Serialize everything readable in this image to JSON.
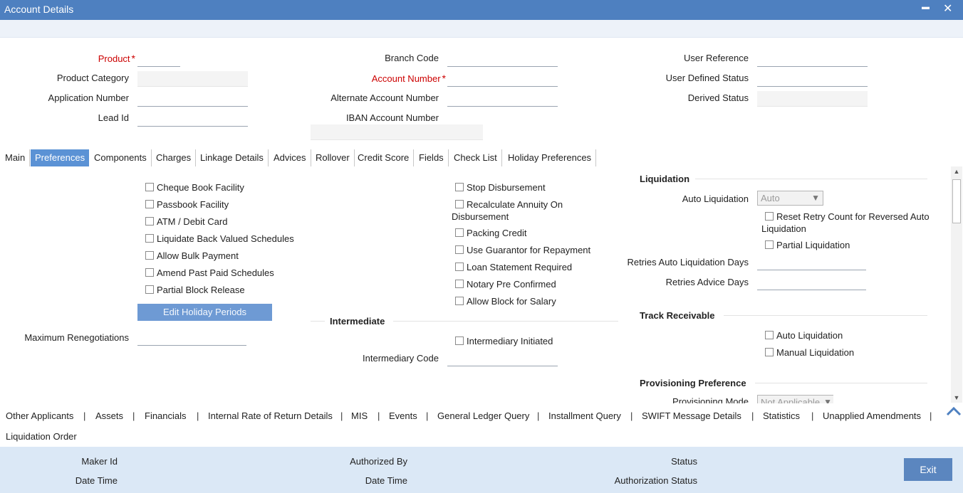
{
  "window": {
    "title": "Account Details",
    "minimize_glyph": "▬",
    "close_glyph": "✕"
  },
  "header": {
    "product_label": "Product",
    "product_category_label": "Product Category",
    "application_number_label": "Application Number",
    "lead_id_label": "Lead Id",
    "branch_code_label": "Branch Code",
    "account_number_label": "Account Number",
    "alternate_account_number_label": "Alternate Account Number",
    "iban_account_number_label": "IBAN Account Number",
    "user_reference_label": "User Reference",
    "user_defined_status_label": "User Defined Status",
    "derived_status_label": "Derived Status",
    "required_marker": "*"
  },
  "tabs": [
    "Main",
    "Preferences",
    "Components",
    "Charges",
    "Linkage Details",
    "Advices",
    "Rollover",
    "Credit Score",
    "Fields",
    "Check List",
    "Holiday Preferences"
  ],
  "preferences": {
    "left_checks": [
      "Cheque Book Facility",
      "Passbook Facility",
      "ATM / Debit Card",
      "Liquidate Back Valued Schedules",
      "Allow Bulk Payment",
      "Amend Past Paid Schedules",
      "Partial Block Release"
    ],
    "edit_holiday_button": "Edit Holiday Periods",
    "max_renegotiations_label": "Maximum Renegotiations",
    "middle_checks": [
      "Stop Disbursement",
      "Recalculate Annuity On",
      "Packing Credit",
      "Use Guarantor for Repayment",
      "Loan Statement Required",
      "Notary Pre Confirmed",
      "Allow Block for Salary"
    ],
    "recalc_line2": "Disbursement",
    "intermediate_title": "Intermediate",
    "intermediary_initiated": "Intermediary Initiated",
    "intermediary_code_label": "Intermediary Code",
    "liquidation_title": "Liquidation",
    "auto_liquidation_label": "Auto Liquidation",
    "auto_liquidation_value": "Auto",
    "reset_retry_line1": "Reset Retry Count for Reversed Auto",
    "reset_retry_line2": "Liquidation",
    "partial_liquidation": "Partial Liquidation",
    "retries_auto_days_label": "Retries Auto Liquidation Days",
    "retries_advice_days_label": "Retries Advice Days",
    "track_receivable_title": "Track Receivable",
    "track_auto_liquidation": "Auto Liquidation",
    "track_manual_liquidation": "Manual Liquidation",
    "provisioning_title": "Provisioning Preference",
    "provisioning_mode_label": "Provisioning Mode",
    "provisioning_mode_value": "Not Applicable"
  },
  "links": [
    "Other Applicants",
    "Assets",
    "Financials",
    "Internal Rate of Return Details",
    "MIS",
    "Events",
    "General Ledger Query",
    "Installment Query",
    "SWIFT Message Details",
    "Statistics",
    "Unapplied Amendments"
  ],
  "links_row2": "Liquidation Order",
  "link_separator": "|",
  "footer": {
    "maker_id_label": "Maker Id",
    "date_time_label": "Date Time",
    "authorized_by_label": "Authorized By",
    "date_time2_label": "Date Time",
    "status_label": "Status",
    "authorization_status_label": "Authorization Status",
    "exit_label": "Exit"
  },
  "colors": {
    "titlebar": "#4e80c0",
    "active_tab": "#5b92d5",
    "required": "#cc0000",
    "footer": "#dbe8f6"
  }
}
